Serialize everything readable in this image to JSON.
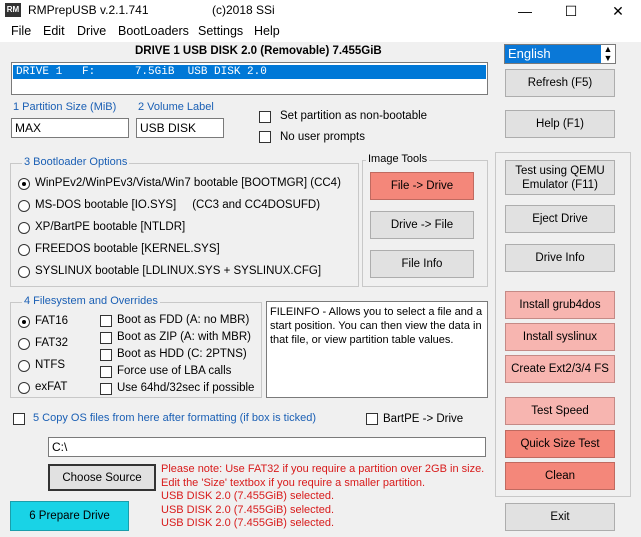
{
  "window": {
    "app_icon_text": "RM",
    "title": "RMPrepUSB v.2.1.741",
    "copyright": "(c)2018 SSi",
    "minimize": "—",
    "maximize": "☐",
    "close": "✕"
  },
  "menu": [
    "File",
    "Edit",
    "Drive",
    "BootLoaders",
    "Settings",
    "Help"
  ],
  "drive_header": "DRIVE 1 USB DISK 2.0  (Removable) 7.455GiB",
  "language": {
    "selected": "English",
    "arrow_up": "▲",
    "arrow_down": "▼"
  },
  "drive_list": [
    "DRIVE 1   F:      7.5GiB  USB DISK 2.0"
  ],
  "partition": {
    "size_label": "1 Partition Size (MiB)",
    "size_value": "MAX",
    "volume_label_label": "2 Volume Label",
    "volume_value": "USB DISK",
    "non_bootable": "Set partition as non-bootable",
    "no_prompts": "No user prompts"
  },
  "bootloader": {
    "title": "3 Bootloader Options",
    "options": [
      "WinPEv2/WinPEv3/Vista/Win7 bootable [BOOTMGR] (CC4)",
      "MS-DOS bootable [IO.SYS]     (CC3 and CC4DOSUFD)",
      "XP/BartPE bootable [NTLDR]",
      "FREEDOS bootable [KERNEL.SYS]",
      "SYSLINUX bootable [LDLINUX.SYS + SYSLINUX.CFG]"
    ],
    "selected_index": 0
  },
  "image_tools": {
    "title": "Image Tools",
    "file_to_drive": "File -> Drive",
    "drive_to_file": "Drive -> File",
    "file_info": "File Info"
  },
  "filesystem": {
    "title": "4 Filesystem and Overrides",
    "types": [
      "FAT16",
      "FAT32",
      "NTFS",
      "exFAT"
    ],
    "selected_index": 0,
    "overrides": [
      "Boot as FDD (A: no MBR)",
      "Boot as ZIP (A: with MBR)",
      "Boot as HDD (C: 2PTNS)",
      "Force use of LBA calls",
      "Use 64hd/32sec if possible"
    ]
  },
  "info_text": "FILEINFO - Allows you to select a file and a start position. You can then view the data in that file, or view partition table values.",
  "copy_os": {
    "label": "5 Copy OS files from here after formatting (if box is ticked)",
    "bartpe": "BartPE -> Drive"
  },
  "source_path": "C:\\",
  "choose_source": "Choose Source",
  "prepare_drive": "6 Prepare Drive",
  "status_lines": [
    "Please note: Use FAT32 if you require a partition over 2GB in size.",
    "Edit the 'Size' textbox if you require a smaller partition.",
    "USB DISK 2.0 (7.455GiB) selected.",
    "USB DISK 2.0 (7.455GiB) selected.",
    "USB DISK 2.0 (7.455GiB) selected."
  ],
  "right_buttons": {
    "refresh": "Refresh (F5)",
    "help": "Help (F1)",
    "test_qemu": "Test using QEMU Emulator (F11)",
    "eject": "Eject Drive",
    "drive_info": "Drive Info",
    "grub4dos": "Install grub4dos",
    "syslinux": "Install syslinux",
    "ext": "Create Ext2/3/4 FS",
    "test_speed": "Test Speed",
    "quick_size": "Quick Size Test",
    "clean": "Clean",
    "exit": "Exit"
  },
  "colors": {
    "selection_blue": "#0078d7",
    "red_button": "#f4877a",
    "pink_button": "#f7b5b0",
    "cyan_button": "#19d3e6",
    "status_red": "#d81b1b",
    "label_blue": "#1a5fb4"
  }
}
